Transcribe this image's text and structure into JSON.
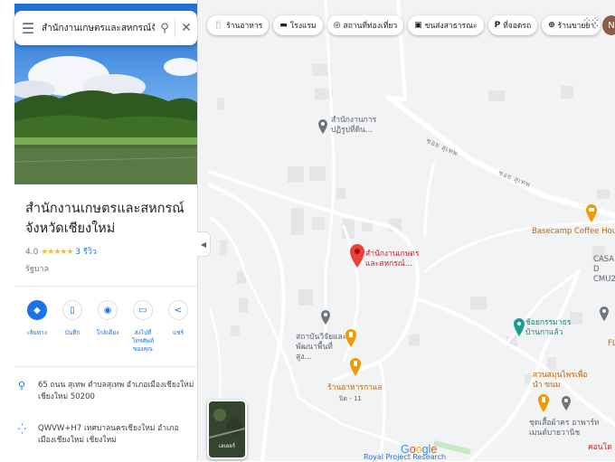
{
  "search": {
    "query": "สำนักงานเกษตรและสหกรณ์จังหวัดเชียงใหม่"
  },
  "place": {
    "title": "สำนักงานเกษตรและสหกรณ์จังหวัดเชียงใหม่",
    "rating": "4.0",
    "stars": "★★★★★",
    "reviews": "3 รีวิว",
    "category": "รัฐบาล"
  },
  "actions": [
    {
      "label": "เส้นทาง"
    },
    {
      "label": "บันทึก"
    },
    {
      "label": "ใกล้เคียง"
    },
    {
      "label": "ส่งไปที่โทรศัพท์ของคุณ"
    },
    {
      "label": "แชร์"
    }
  ],
  "info": {
    "address": "65 ถนน สุเทพ ตำบลสุเทพ อำเภอเมืองเชียงใหม่ เชียงใหม่ 50200",
    "pluscode": "QWVW+H7 เทศบาลนครเชียงใหม่ อำเภอเมืองเชียงใหม่ เชียงใหม่"
  },
  "chips": [
    "ร้านอาหาร",
    "โรงแรม",
    "สถานที่ท่องเที่ยว",
    "ขนส่งสาธารณะ",
    "ที่จอดรถ",
    "ร้านขายยา"
  ],
  "user": {
    "initial": "N"
  },
  "map": {
    "pois": {
      "p1": "สำนักงานการปฏิรูปที่ดิน...",
      "selected": "สำนักงานเกษตรและสหกรณ์...",
      "basecamp": "Basecamp Coffee House",
      "casa": "CASA D CMU2",
      "institute": "สถาบันวิจัยและพัฒนาพื้นที่สูง...",
      "restaurant": "ร้านอาหารกาแล",
      "restaurant_sub": "ปิด - 11",
      "skywalk": "ช้อยกรรมาธร บ้านกาแล้ว",
      "sweets": "สวนสมุนไพรเพื่อนำ ขนม",
      "dormitory": "ชุดเสื้อผ้าคร อาพาร์ทเมนต์บายวานิช",
      "royal": "Royal Project Research",
      "partial_right": "คอนโด",
      "partial_fl": "FL"
    },
    "streets": [
      "ซอย สุเทพ",
      "ซอย สุเทพ"
    ],
    "attribution": "Google",
    "layers_label": "เลเยอร์"
  }
}
